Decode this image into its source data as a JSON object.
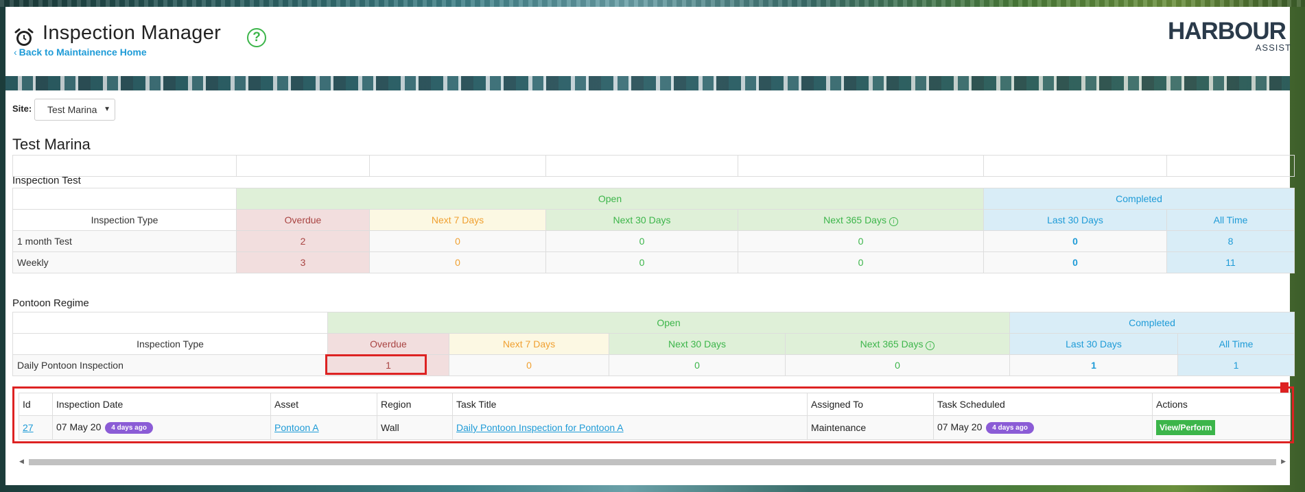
{
  "header": {
    "title": "Inspection Manager",
    "help": "?",
    "back_link": "Back to Maintainence Home",
    "logo_main": "HARBOUR",
    "logo_sub": "ASSIST"
  },
  "site": {
    "label": "Site:",
    "selected": "Test Marina",
    "heading": "Test Marina"
  },
  "colors": {
    "green": "#3cb54a",
    "blue": "#1e9bd7",
    "red": "#a94442",
    "orange": "#f0a030",
    "badge": "#8b5cd6",
    "highlight": "#dd2222"
  },
  "regimes": [
    {
      "title": "Inspection Test",
      "group_open": "Open",
      "group_completed": "Completed",
      "columns": [
        "Inspection Type",
        "Overdue",
        "Next 7 Days",
        "Next 30 Days",
        "Next 365 Days",
        "Last 30 Days",
        "All Time"
      ],
      "rows": [
        {
          "type": "1 month Test",
          "overdue": "2",
          "next7": "0",
          "next30": "0",
          "next365": "0",
          "last30": "0",
          "all": "8"
        },
        {
          "type": "Weekly",
          "overdue": "3",
          "next7": "0",
          "next30": "0",
          "next365": "0",
          "last30": "0",
          "all": "11"
        }
      ]
    },
    {
      "title": "Pontoon Regime",
      "group_open": "Open",
      "group_completed": "Completed",
      "columns": [
        "Inspection Type",
        "Overdue",
        "Next 7 Days",
        "Next 30 Days",
        "Next 365 Days",
        "Last 30 Days",
        "All Time"
      ],
      "rows": [
        {
          "type": "Daily Pontoon Inspection",
          "overdue": "1",
          "next7": "0",
          "next30": "0",
          "next365": "0",
          "last30": "1",
          "all": "1"
        }
      ]
    }
  ],
  "detail": {
    "columns": [
      "Id",
      "Inspection Date",
      "Asset",
      "Region",
      "Task Title",
      "Assigned To",
      "Task Scheduled",
      "Actions"
    ],
    "rows": [
      {
        "id": "27",
        "inspection_date": "07 May 20",
        "inspection_badge": "4 days ago",
        "asset": "Pontoon A",
        "region": "Wall",
        "task_title": "Daily Pontoon Inspection for Pontoon A",
        "assigned_to": "Maintenance",
        "task_scheduled": "07 May 20",
        "scheduled_badge": "4 days ago",
        "action": "View/Perform"
      }
    ]
  }
}
